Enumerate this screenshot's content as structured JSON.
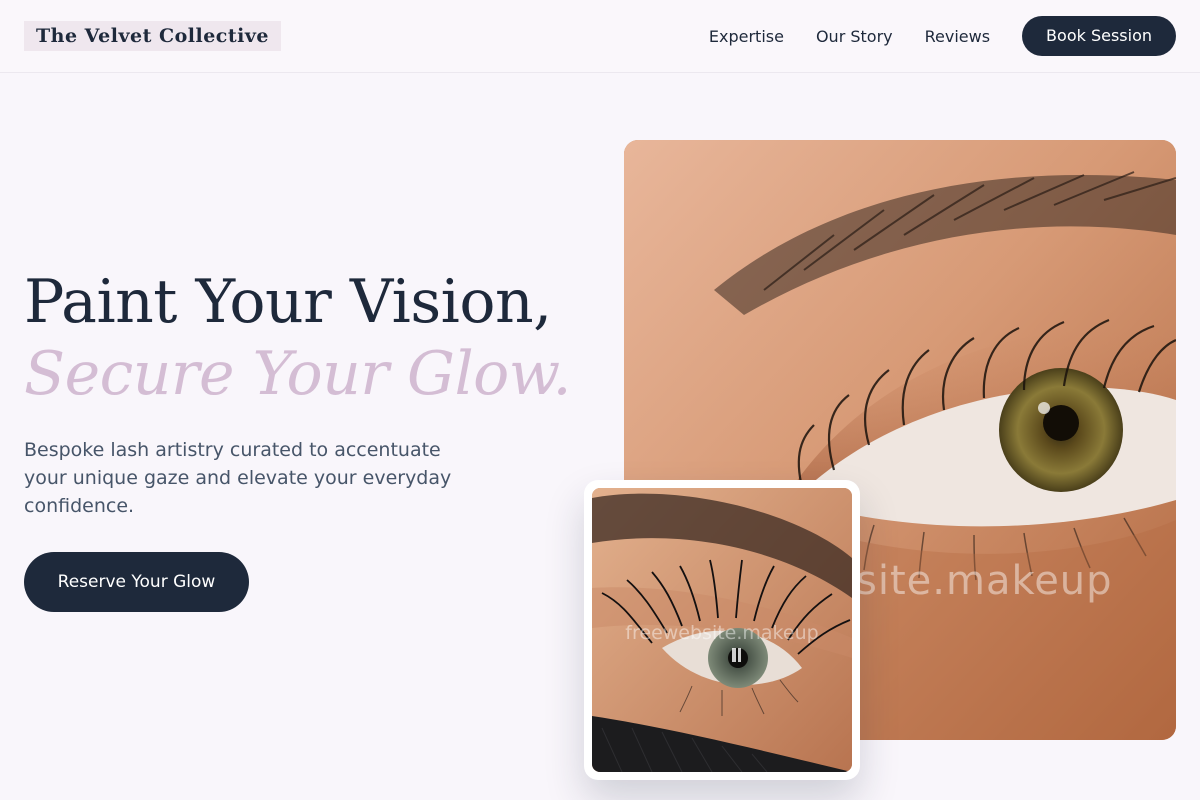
{
  "header": {
    "logo": "The Velvet Collective",
    "nav": [
      {
        "label": "Expertise"
      },
      {
        "label": "Our Story"
      },
      {
        "label": "Reviews"
      }
    ],
    "cta_label": "Book Session"
  },
  "hero": {
    "title_line_1": "Paint Your Vision,",
    "title_line_2": "Secure Your Glow.",
    "subtitle": "Bespoke lash artistry curated to accentuate your unique gaze and elevate your everyday confidence.",
    "cta_label": "Reserve Your Glow"
  },
  "images": {
    "main_watermark": "freewebsite.makeup",
    "inset_watermark": "freewebsite.makeup",
    "main_description_icon": "eye-closeup-photo",
    "inset_description_icon": "lash-extension-photo"
  },
  "colors": {
    "primary": "#1e293b",
    "accent": "#d4bdd4",
    "background": "#f9f6fb",
    "muted_text": "#475569"
  }
}
